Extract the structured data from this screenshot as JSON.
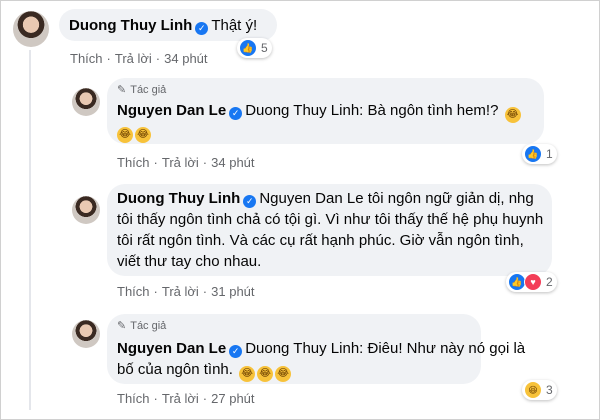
{
  "verified_color": "#1877f2",
  "actions": {
    "like": "Thích",
    "reply": "Trả lời",
    "dot": "·"
  },
  "author_tag": "Tác giả",
  "comments": [
    {
      "author": "Duong Thuy Linh",
      "mention": "",
      "text": "Thật ý!",
      "time": "34 phút",
      "reactions": {
        "types": [
          "like"
        ],
        "count": "5"
      }
    },
    {
      "author": "Nguyen Dan Le",
      "is_author": true,
      "mention": "Duong Thuy Linh:",
      "text": "Bà ngôn tình hem!?",
      "emojis": [
        "haha",
        "haha",
        "haha"
      ],
      "time": "34 phút",
      "reactions": {
        "types": [
          "like"
        ],
        "count": "1"
      }
    },
    {
      "author": "Duong Thuy Linh",
      "mention": "Nguyen Dan Le",
      "text_lines": [
        "tôi ngôn ngữ giản dị, nhg",
        "tôi thấy ngôn tình chả có tội gì. Vì như tôi thấy thế hệ phụ huynh",
        "tôi rất ngôn tình. Và các cụ rất hạnh phúc. Giờ vẫn ngôn tình,",
        "viết thư tay cho nhau."
      ],
      "time": "31 phút",
      "reactions": {
        "types": [
          "like",
          "love"
        ],
        "count": "2"
      }
    },
    {
      "author": "Nguyen Dan Le",
      "is_author": true,
      "mention": "Duong Thuy Linh:",
      "text_lines": [
        "Điêu! Như này nó gọi là",
        "bố của ngôn tình."
      ],
      "emojis": [
        "haha",
        "haha",
        "haha"
      ],
      "time": "27 phút",
      "reactions": {
        "types": [
          "haha"
        ],
        "count": "3"
      }
    }
  ]
}
